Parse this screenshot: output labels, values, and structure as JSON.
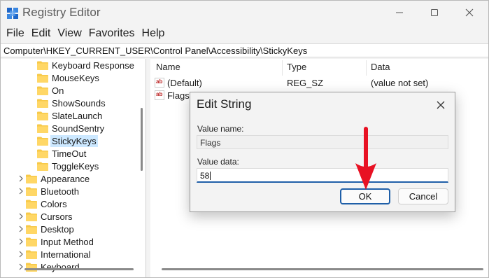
{
  "window": {
    "title": "Registry Editor",
    "icon": "registry-editor-icon"
  },
  "menu": [
    "File",
    "Edit",
    "View",
    "Favorites",
    "Help"
  ],
  "address": "Computer\\HKEY_CURRENT_USER\\Control Panel\\Accessibility\\StickyKeys",
  "tree": {
    "items": [
      {
        "label": "Keyboard Response",
        "expandable": false,
        "selected": false
      },
      {
        "label": "MouseKeys",
        "expandable": false,
        "selected": false
      },
      {
        "label": "On",
        "expandable": false,
        "selected": false
      },
      {
        "label": "ShowSounds",
        "expandable": false,
        "selected": false
      },
      {
        "label": "SlateLaunch",
        "expandable": false,
        "selected": false
      },
      {
        "label": "SoundSentry",
        "expandable": false,
        "selected": false
      },
      {
        "label": "StickyKeys",
        "expandable": false,
        "selected": true
      },
      {
        "label": "TimeOut",
        "expandable": false,
        "selected": false
      },
      {
        "label": "ToggleKeys",
        "expandable": false,
        "selected": false
      },
      {
        "label": "Appearance",
        "expandable": true,
        "selected": false
      },
      {
        "label": "Bluetooth",
        "expandable": true,
        "selected": false
      },
      {
        "label": "Colors",
        "expandable": false,
        "selected": false
      },
      {
        "label": "Cursors",
        "expandable": true,
        "selected": false
      },
      {
        "label": "Desktop",
        "expandable": true,
        "selected": false
      },
      {
        "label": "Input Method",
        "expandable": true,
        "selected": false
      },
      {
        "label": "International",
        "expandable": true,
        "selected": false
      },
      {
        "label": "Keyboard",
        "expandable": true,
        "selected": false
      }
    ]
  },
  "values": {
    "columns": [
      "Name",
      "Type",
      "Data"
    ],
    "rows": [
      {
        "name": "(Default)",
        "type": "REG_SZ",
        "data": "(value not set)",
        "icon": "ab"
      },
      {
        "name": "Flags",
        "type": "",
        "data": "",
        "icon": "ab"
      }
    ]
  },
  "dialog": {
    "title": "Edit String",
    "value_name_label": "Value name:",
    "value_name": "Flags",
    "value_data_label": "Value data:",
    "value_data": "58",
    "ok_label": "OK",
    "cancel_label": "Cancel"
  },
  "colors": {
    "selection": "#cce8ff",
    "accent": "#1f5fa8",
    "folder": "#f7c948",
    "annotation_arrow": "#e81123"
  }
}
